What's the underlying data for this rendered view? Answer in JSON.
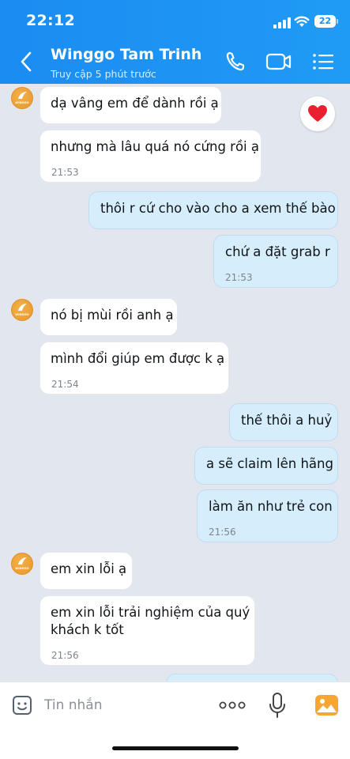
{
  "status_bar": {
    "time": "22:12",
    "battery": "22"
  },
  "header": {
    "contact_name": "Winggo Tam Trinh",
    "contact_status": "Truy cập 5 phút trước"
  },
  "avatar_label": "WINGGO",
  "messages": [
    {
      "side": "in",
      "text": "dạ vâng em để dành rồi ạ"
    },
    {
      "side": "in",
      "text": "nhưng mà lâu quá nó cứng rồi ạ",
      "time": "21:53"
    },
    {
      "side": "out",
      "text": "thôi r cứ cho vào cho a xem thế bào"
    },
    {
      "side": "out",
      "text": "chứ a đặt grab r",
      "time": "21:53"
    },
    {
      "side": "in",
      "text": "nó bị mùi rồi anh ạ"
    },
    {
      "side": "in",
      "text": "mình đổi giúp em được k ạ",
      "time": "21:54"
    },
    {
      "side": "out",
      "text": "thế thôi a huỷ"
    },
    {
      "side": "out",
      "text": "a sẽ claim lên hãng"
    },
    {
      "side": "out",
      "text": "làm ăn như trẻ con",
      "time": "21:56"
    },
    {
      "side": "in",
      "text": "em xin lỗi ạ"
    },
    {
      "side": "in",
      "text": "em xin lỗi trải nghiệm của quý khách k tốt",
      "time": "21:56"
    }
  ],
  "reaction": {
    "icon": "heart-icon",
    "color": "#e8202f"
  },
  "input_bar": {
    "placeholder": "Tin nhắn"
  },
  "colors": {
    "header": "#1b8cf2",
    "incoming_bubble": "#ffffff",
    "outgoing_bubble": "#d6edfb",
    "background": "#e2e7ef"
  }
}
